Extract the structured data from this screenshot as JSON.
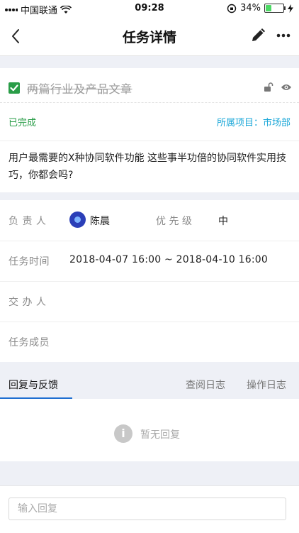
{
  "status_bar": {
    "carrier": "中国联通",
    "time": "09:28",
    "battery_percent_label": "34%",
    "battery_level": 0.34
  },
  "navbar": {
    "title": "任务详情"
  },
  "task": {
    "title": "两篇行业及产品文章",
    "status": "已完成",
    "project_label": "所属项目：",
    "project_name": "市场部",
    "description": "用户最需要的X种协同软件功能 这些事半功倍的协同软件实用技巧，你都会吗?"
  },
  "details": {
    "owner_label": "负 责 人",
    "owner_name": "陈晨",
    "priority_label": "优 先 级",
    "priority_value": "中",
    "time_label": "任务时间",
    "time_value": "2018-04-07 16:00 ~ 2018-04-10 16:00",
    "assigner_label": "交 办 人",
    "members_label": "任务成员"
  },
  "tabs": [
    {
      "label": "回复与反馈",
      "active": true
    },
    {
      "label": "查阅日志",
      "active": false
    },
    {
      "label": "操作日志",
      "active": false
    }
  ],
  "replies": {
    "empty_text": "暂无回复"
  },
  "reply_input": {
    "placeholder": "输入回复"
  },
  "colors": {
    "accent_green": "#2a9d48",
    "link_blue": "#1aa7d8",
    "tab_underline": "#1f6fd1"
  }
}
